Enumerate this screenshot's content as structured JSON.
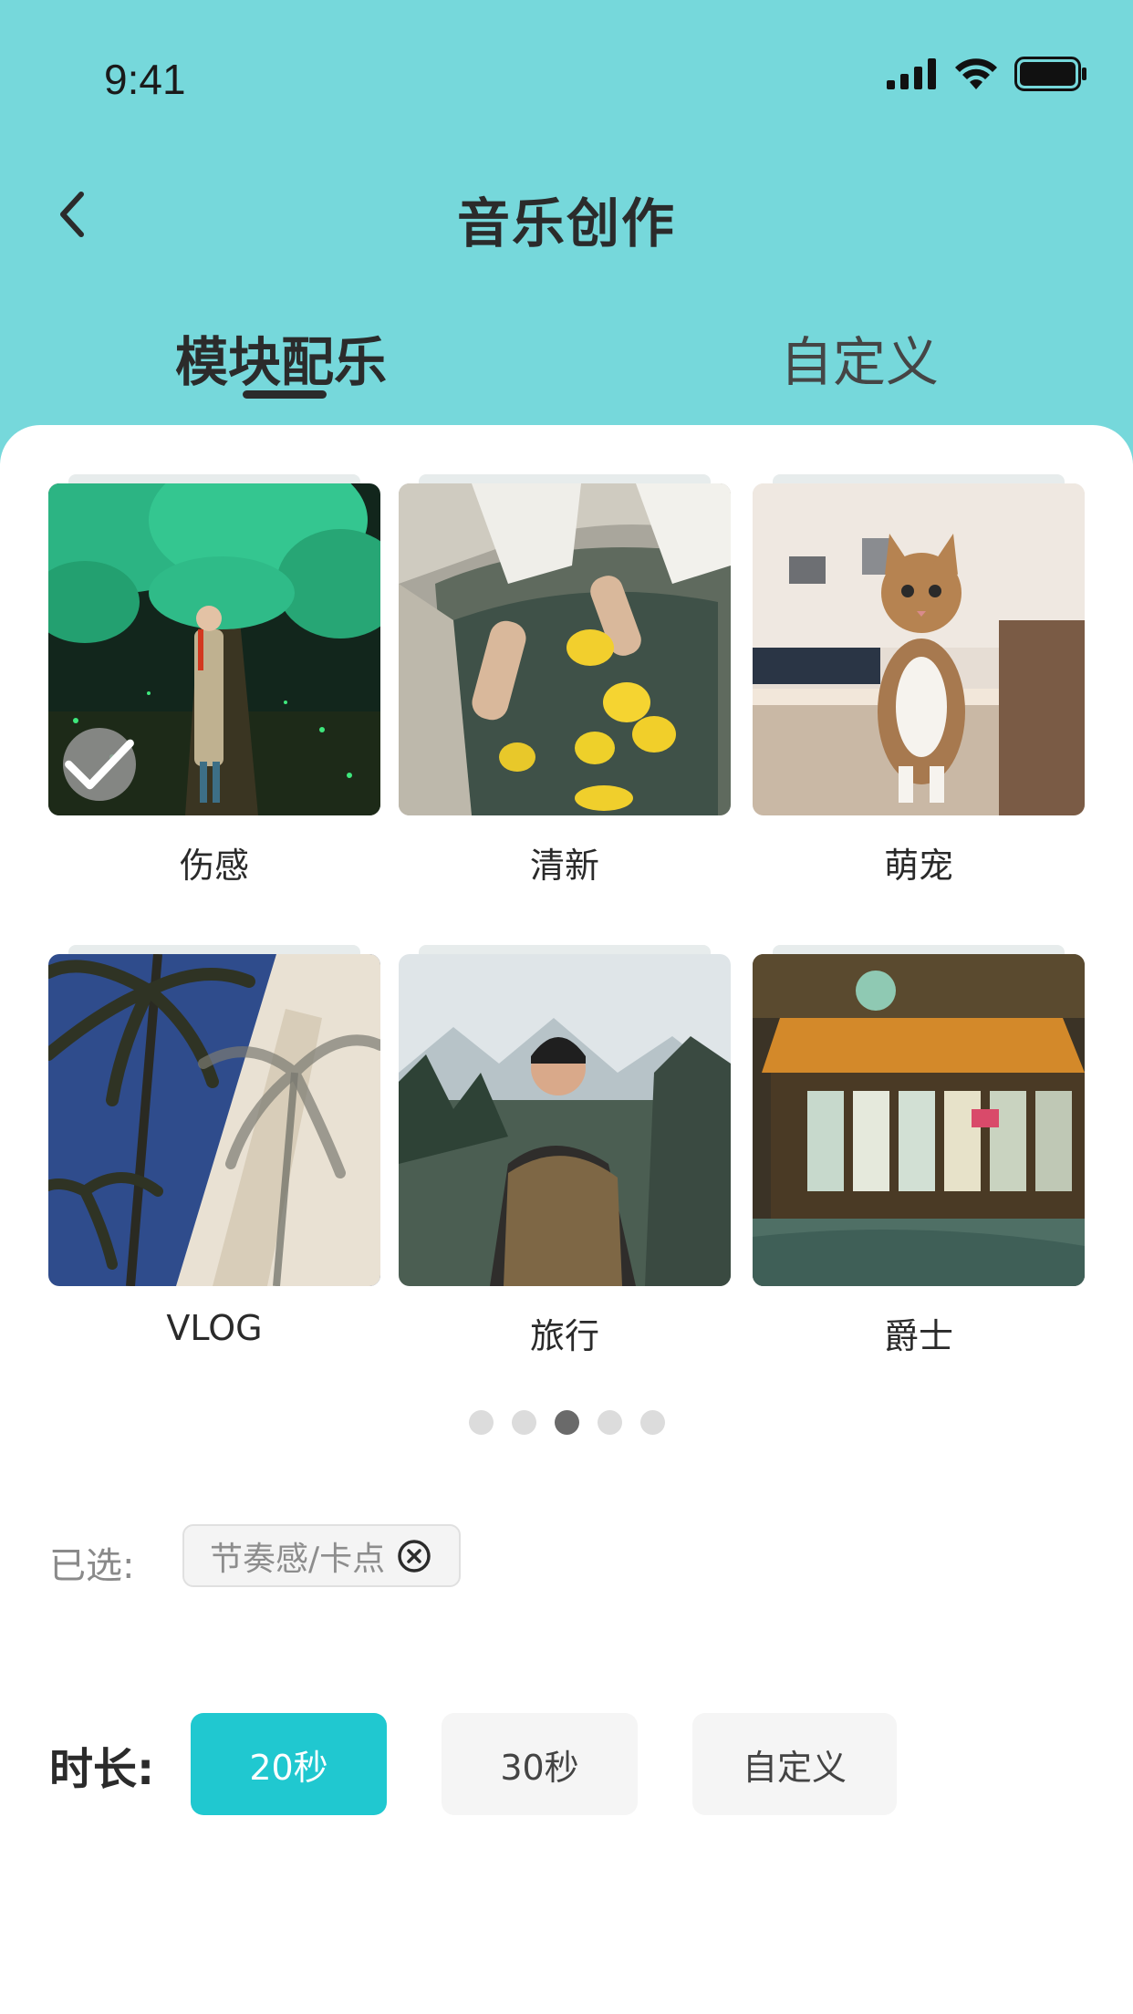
{
  "status_bar": {
    "time": "9:41"
  },
  "nav": {
    "title": "音乐创作"
  },
  "tabs": [
    {
      "label": "模块配乐",
      "active": true
    },
    {
      "label": "自定义",
      "active": false
    }
  ],
  "grid": [
    {
      "label": "伤感",
      "image": "forest-figure-illustration",
      "selected": true
    },
    {
      "label": "清新",
      "image": "lemons-in-water-photo",
      "selected": false
    },
    {
      "label": "萌宠",
      "image": "cat-photo",
      "selected": false
    },
    {
      "label": "VLOG",
      "image": "palm-trees-photo",
      "selected": false
    },
    {
      "label": "旅行",
      "image": "hiker-mountains-photo",
      "selected": false
    },
    {
      "label": "爵士",
      "image": "night-storefront-photo",
      "selected": false
    }
  ],
  "pagination": {
    "count": 5,
    "active_index": 2
  },
  "selected": {
    "label": "已选:",
    "chip": "节奏感/卡点"
  },
  "duration": {
    "label": "时长:",
    "options": [
      {
        "label": "20秒",
        "active": true
      },
      {
        "label": "30秒",
        "active": false
      },
      {
        "label": "自定义",
        "active": false
      }
    ]
  },
  "colors": {
    "header_bg": "#76d8db",
    "accent": "#20c8d0"
  }
}
